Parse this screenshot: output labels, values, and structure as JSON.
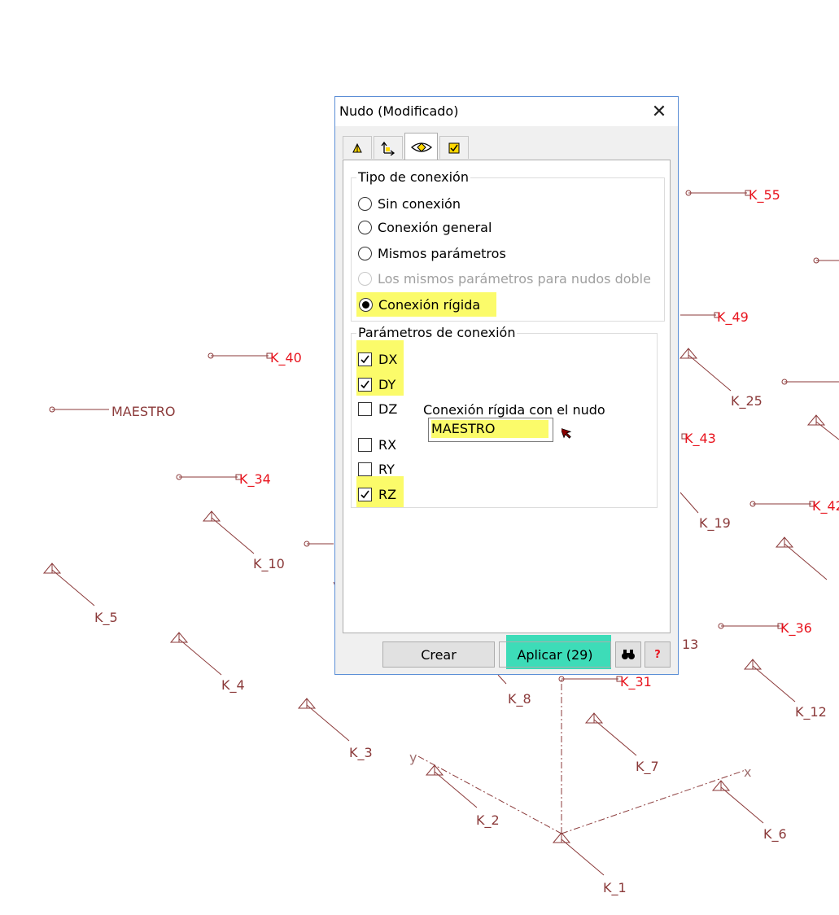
{
  "dialog": {
    "title": "Nudo (Modificado)",
    "tabs": [
      {
        "icon": "support-icon"
      },
      {
        "icon": "axes-icon"
      },
      {
        "icon": "connection-eye-icon",
        "active": true
      },
      {
        "icon": "checkbox-tab-icon"
      }
    ],
    "connection_type": {
      "title": "Tipo de conexión",
      "options": [
        {
          "label": "Sin conexión",
          "selected": false,
          "enabled": true
        },
        {
          "label": "Conexión general",
          "selected": false,
          "enabled": true
        },
        {
          "label": "Mismos parámetros",
          "selected": false,
          "enabled": true
        },
        {
          "label": "Los mismos parámetros para nudos doble",
          "selected": false,
          "enabled": false
        },
        {
          "label": "Conexión rígida",
          "selected": true,
          "enabled": true
        }
      ]
    },
    "parameters": {
      "title": "Parámetros de conexión",
      "checks": [
        {
          "label": "DX",
          "checked": true
        },
        {
          "label": "DY",
          "checked": true
        },
        {
          "label": "DZ",
          "checked": false
        },
        {
          "label": "RX",
          "checked": false
        },
        {
          "label": "RY",
          "checked": false
        },
        {
          "label": "RZ",
          "checked": true
        }
      ],
      "rigid_label": "Conexión rígida con el nudo",
      "rigid_node": "MAESTRO"
    },
    "buttons": {
      "create": "Crear",
      "apply": "Aplicar (29)",
      "find_icon": "binoculars-icon",
      "help": "?"
    },
    "highlight_color": "#fbfb6a",
    "apply_highlight_color": "#3ddcb8"
  },
  "canvas": {
    "red_labels": [
      "K_55",
      "K_49",
      "K_40",
      "K_43",
      "K_34",
      "K_42",
      "K_36",
      "K_31"
    ],
    "dark_labels": [
      "MAESTRO",
      "K_25",
      "K_19",
      "K_10",
      "K_5",
      "K_4",
      "K_3",
      "K_2",
      "K_1",
      "K_6",
      "K_7",
      "K_8",
      "K_12",
      "13"
    ],
    "axis_labels": [
      "x",
      "y"
    ],
    "label_color_red": "#e8141e",
    "label_color_dark": "#8b3a3a"
  }
}
